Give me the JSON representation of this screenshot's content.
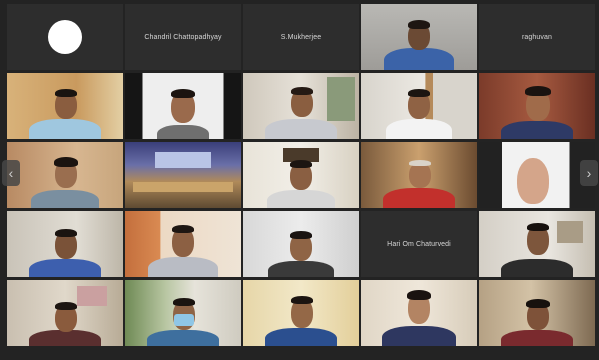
{
  "meeting": {
    "participants": {
      "r1c2": "Chandril Chattopadhyay",
      "r1c3": "S.Mukherjee",
      "r1c5": "raghuvan",
      "r4c4": "Hari Om Chaturvedi"
    },
    "navigation": {
      "prev_icon": "chevron-left-icon",
      "next_icon": "chevron-right-icon",
      "prev_glyph": "‹",
      "next_glyph": "›"
    }
  }
}
